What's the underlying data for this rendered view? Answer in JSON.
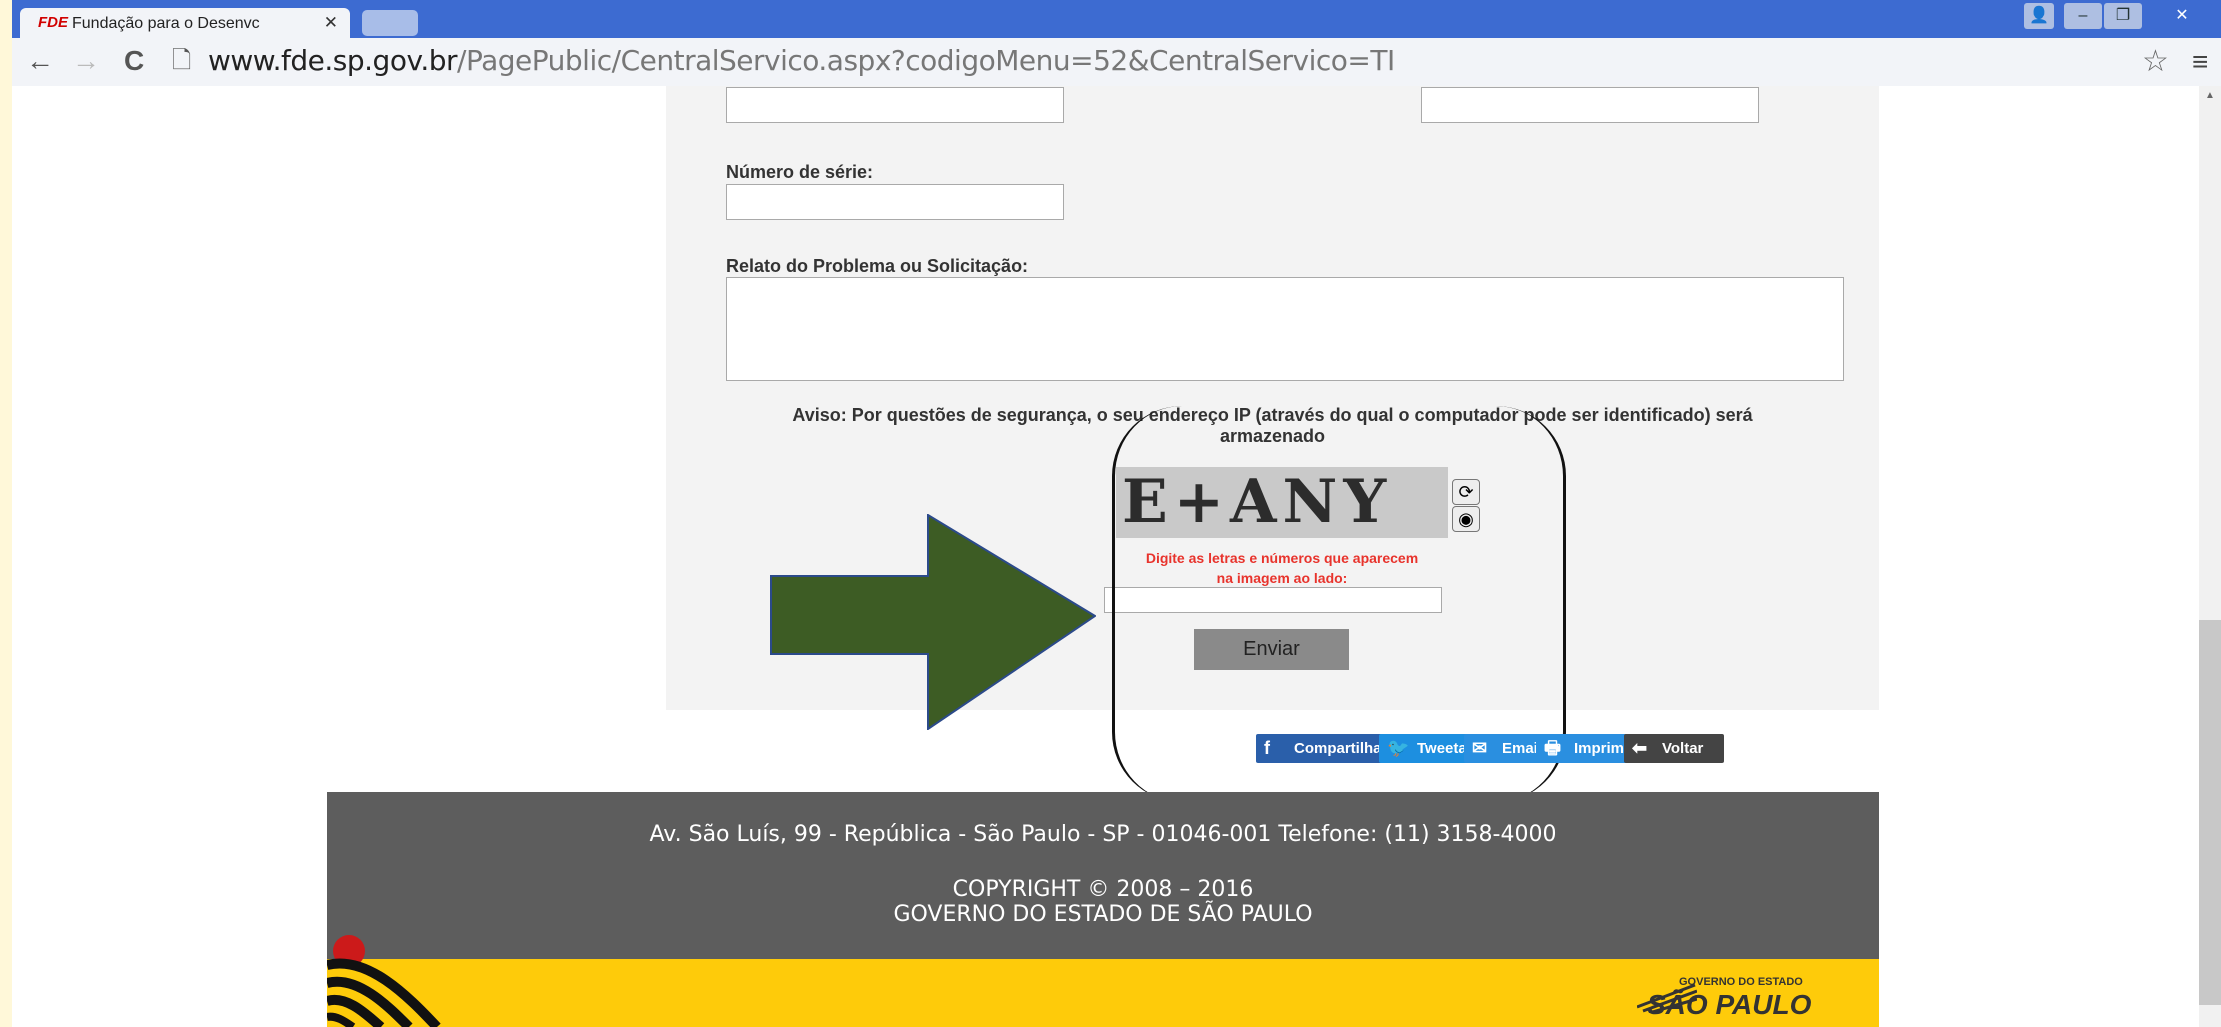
{
  "browser": {
    "tab_title": "Fundação para o Desenvc",
    "favicon_text": "FDE",
    "close_glyph": "✕",
    "url_domain": "www.fde.sp.gov.br",
    "url_path": "/PagePublic/CentralServico.aspx?codigoMenu=52&CentralServico=TI",
    "back_icon": "←",
    "forward_icon": "→",
    "reload_icon": "C",
    "star_icon": "☆",
    "menu_icon": "≡"
  },
  "form": {
    "serial_label": "Número de série:",
    "problem_label": "Relato do Problema ou Solicitação:",
    "notice_line1": "Aviso: Por questões de segurança, o seu endereço IP (através do qual o computador pode ser identificado) será",
    "notice_line2": "armazenado",
    "captcha_text": "E+ANY",
    "captcha_hint_line1": "Digite as letras e números que aparecem",
    "captcha_hint_line2": "na imagem ao lado:",
    "submit_label": "Enviar"
  },
  "share": {
    "facebook": "Compartilhar",
    "twitter": "Tweetar",
    "email": "Email",
    "print": "Imprimir",
    "back": "Voltar",
    "colors": {
      "facebook": "#2a5faa",
      "twitter": "#1d8fe0",
      "email": "#2a8fe0",
      "print": "#2a8fe0",
      "back": "#444444"
    }
  },
  "footer": {
    "address": "Av. São Luís, 99 - República - São Paulo - SP - 01046-001 Telefone: (11) 3158-4000",
    "copyright": "COPYRIGHT © 2008 – 2016",
    "government": "GOVERNO DO ESTADO DE SÃO PAULO",
    "logo_small": "GOVERNO DO ESTADO",
    "logo_big": "SÃO PAULO"
  },
  "annotation": {
    "arrow_color": "#3d5c24"
  }
}
